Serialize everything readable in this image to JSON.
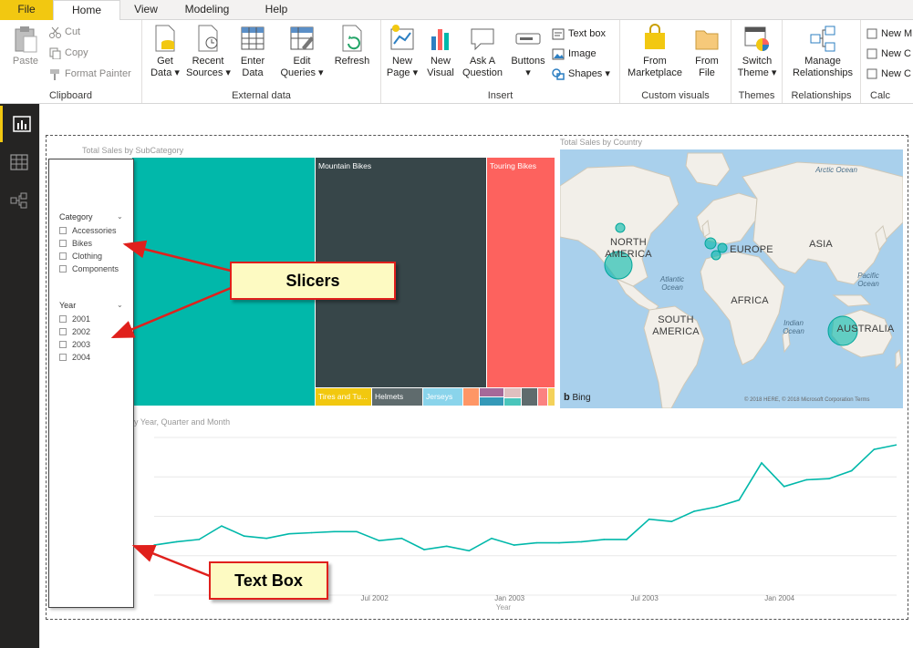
{
  "tabs": [
    "File",
    "Home",
    "View",
    "Modeling",
    "Help"
  ],
  "ribbon": {
    "clipboard": {
      "label": "Clipboard",
      "paste": "Paste",
      "cut": "Cut",
      "copy": "Copy",
      "format_painter": "Format Painter"
    },
    "external": {
      "label": "External data",
      "get_data": "Get\nData ▾",
      "recent_sources": "Recent\nSources ▾",
      "enter_data": "Enter\nData",
      "edit_queries": "Edit\nQueries ▾",
      "refresh": "Refresh"
    },
    "insert": {
      "label": "Insert",
      "new_page": "New\nPage ▾",
      "new_visual": "New\nVisual",
      "ask_question": "Ask A\nQuestion",
      "buttons": "Buttons\n▾",
      "text_box": "Text box",
      "image": "Image",
      "shapes": "Shapes ▾"
    },
    "custom_visuals": {
      "label": "Custom visuals",
      "from_marketplace": "From\nMarketplace",
      "from_file": "From\nFile"
    },
    "themes": {
      "label": "Themes",
      "switch_theme": "Switch\nTheme ▾"
    },
    "relationships": {
      "label": "Relationships",
      "manage": "Manage\nRelationships"
    },
    "calc": {
      "label": "Calc",
      "item1": "New M",
      "item2": "New C",
      "item3": "New C"
    }
  },
  "treemap": {
    "title": "Total Sales by SubCategory",
    "tiles": [
      {
        "label": "",
        "color": "#01b8aa"
      },
      {
        "label": "Mountain Bikes",
        "color": "#374649"
      },
      {
        "label": "Touring Bikes",
        "color": "#fd625e"
      },
      {
        "label": "Tires and Tu...",
        "color": "#f2c80f"
      },
      {
        "label": "Helmets",
        "color": "#5f6b6d"
      },
      {
        "label": "Jerseys",
        "color": "#8ad4eb"
      }
    ]
  },
  "map": {
    "title": "Total Sales by Country",
    "continents": {
      "north_america": "NORTH\nAMERICA",
      "europe": "EUROPE",
      "asia": "ASIA",
      "africa": "AFRICA",
      "south_america": "SOUTH\nAMERICA",
      "australia": "AUSTRALIA"
    },
    "oceans": {
      "arctic": "Arctic Ocean",
      "atlantic": "Atlantic\nOcean",
      "pacific": "Pacific\nOcean",
      "indian": "Indian\nOcean"
    },
    "bing": "Bing",
    "attribution": "© 2018 HERE, © 2018 Microsoft Corporation",
    "terms": "Terms"
  },
  "linechart": {
    "title": "y Year, Quarter and Month",
    "xlabel": "Year",
    "ticks": [
      "Jul 2002",
      "Jan 2003",
      "Jul 2003",
      "Jan 2004"
    ]
  },
  "slicers": {
    "category": {
      "title": "Category",
      "items": [
        "Accessories",
        "Bikes",
        "Clothing",
        "Components"
      ]
    },
    "year": {
      "title": "Year",
      "items": [
        "2001",
        "2002",
        "2003",
        "2004"
      ]
    }
  },
  "callouts": {
    "slicers": "Slicers",
    "textbox": "Text Box"
  },
  "chart_data": {
    "type": "line",
    "title": "",
    "xlabel": "Year",
    "ylabel": "",
    "x_ticks": [
      "Jul 2002",
      "Jan 2003",
      "Jul 2003",
      "Jan 2004"
    ],
    "values": [
      42,
      45,
      47,
      59,
      50,
      48,
      52,
      53,
      54,
      54,
      46,
      48,
      38,
      41,
      37,
      48,
      42,
      44,
      44,
      45,
      47,
      47,
      65,
      63,
      72,
      76,
      82,
      115,
      94,
      100,
      101,
      108,
      127,
      131
    ]
  }
}
